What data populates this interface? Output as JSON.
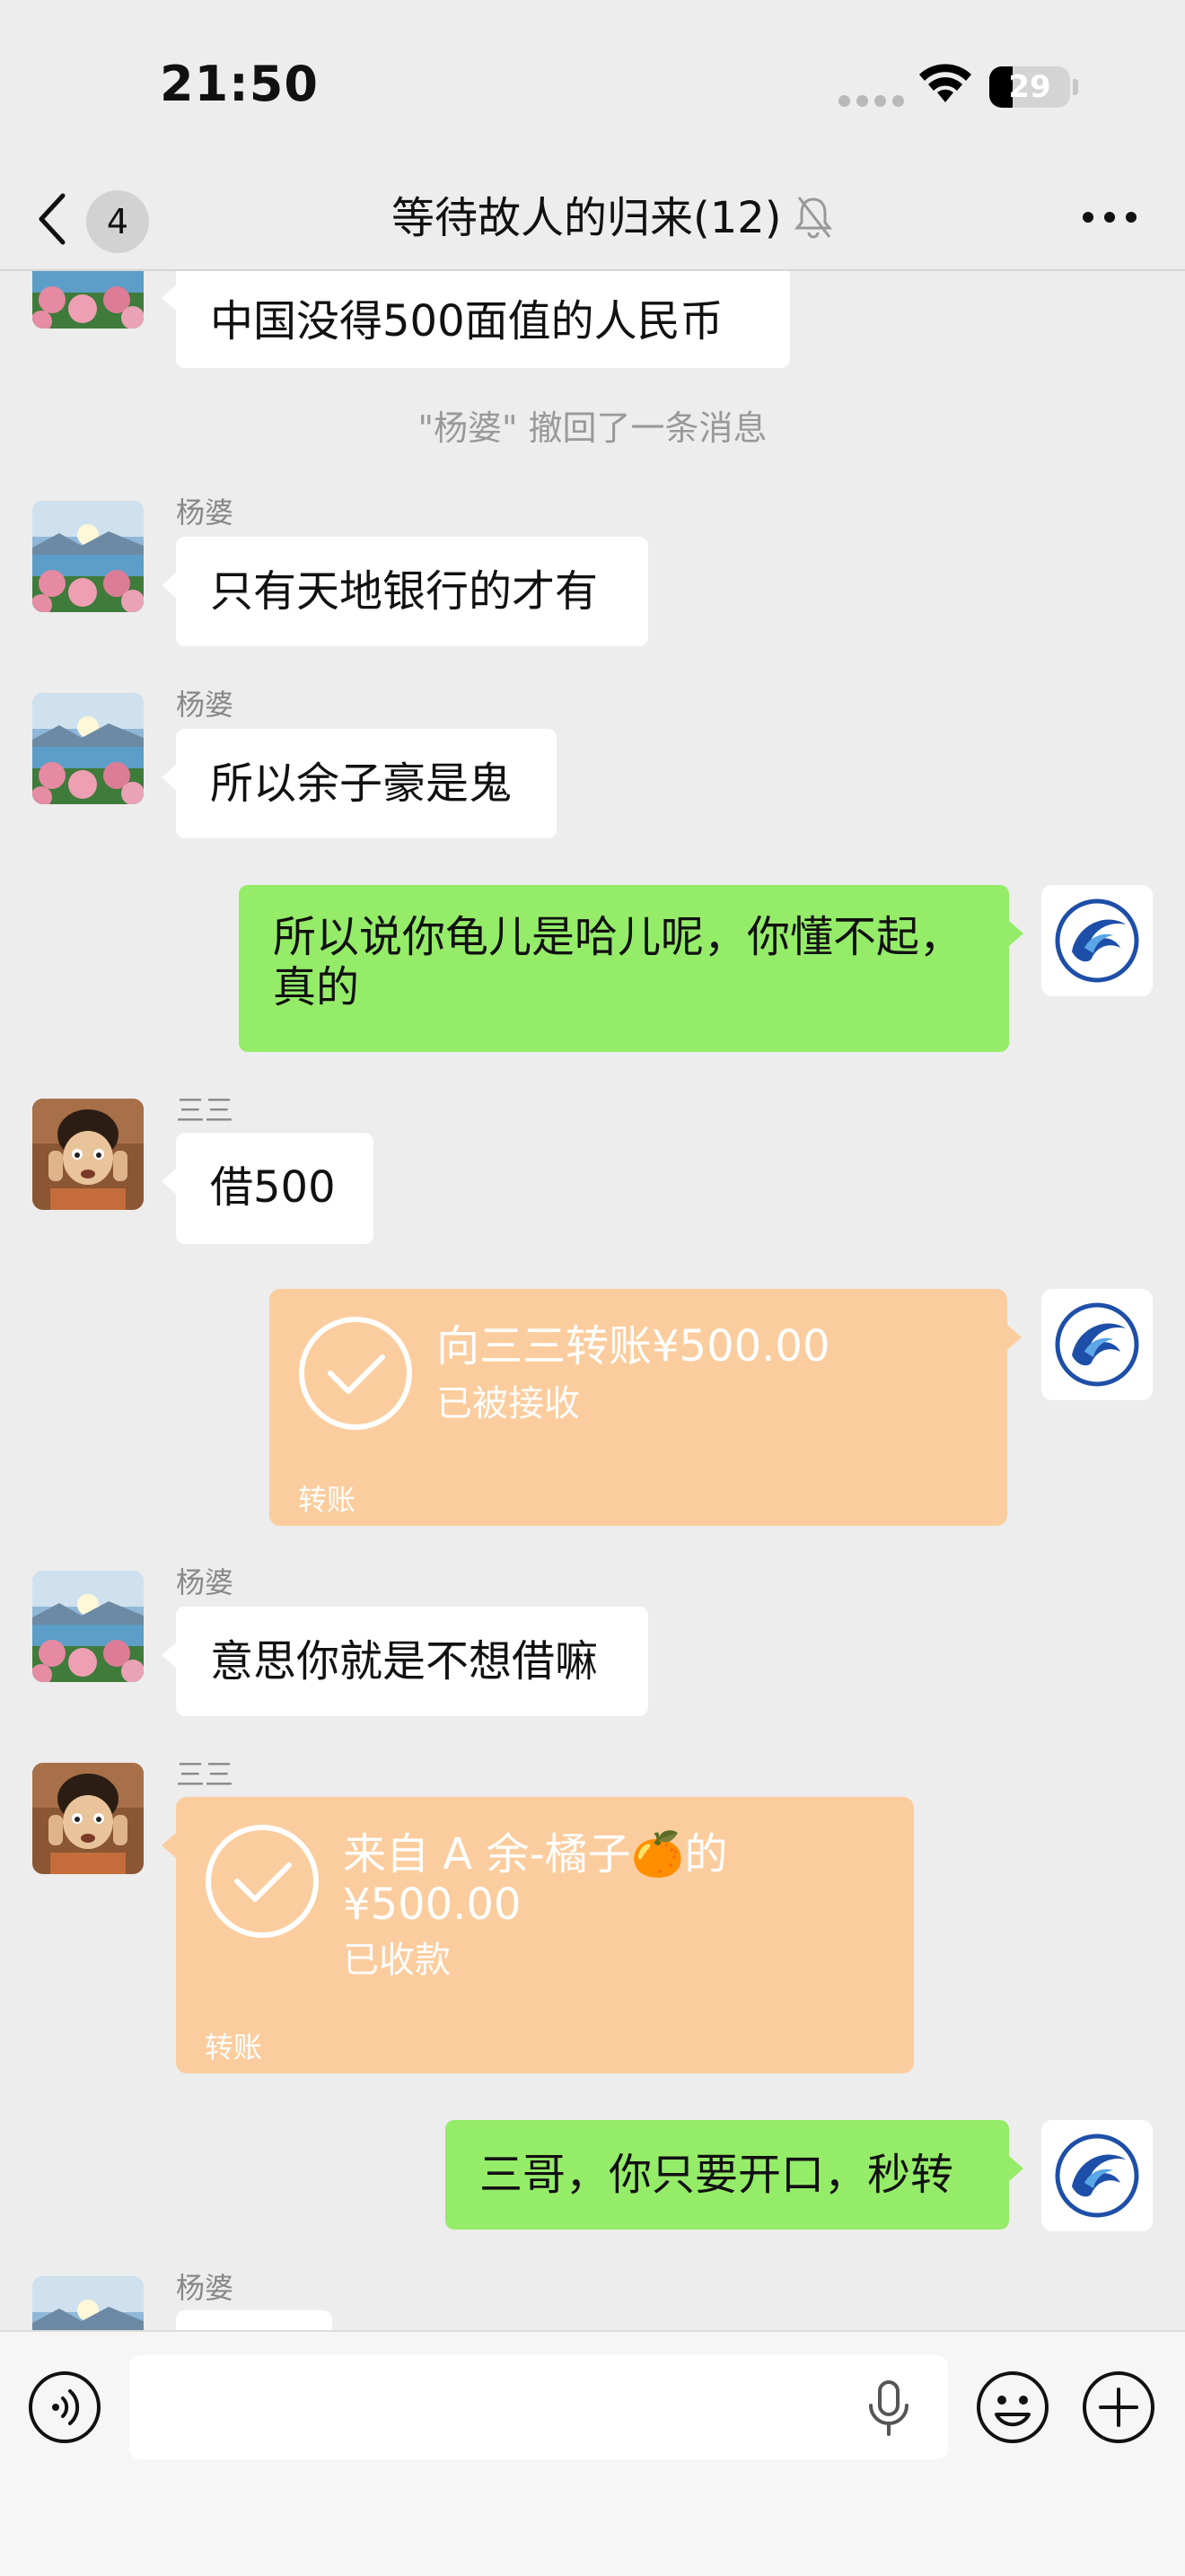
{
  "status": {
    "time": "21:50",
    "battery": "29",
    "battery_level": 0.29
  },
  "header": {
    "back_count": "4",
    "title": "等待故人的归来(12)"
  },
  "messages": [
    {
      "text": "中国没得500面值的人民币"
    },
    {
      "system": "\"杨婆\" 撤回了一条消息"
    },
    {
      "sender": "杨婆",
      "text": "只有天地银行的才有"
    },
    {
      "sender": "杨婆",
      "text": "所以余子豪是鬼"
    },
    {
      "line1": "所以说你龟儿是哈儿呢，你懂不起，",
      "line2": "真的"
    },
    {
      "sender": "三三",
      "text": "借500"
    },
    {
      "title": "向三三转账¥500.00",
      "status": "已被接收",
      "label": "转账"
    },
    {
      "sender": "杨婆",
      "text": "意思你就是不想借嘛"
    },
    {
      "sender": "三三",
      "title_line1": "来自 A 余-橘子🍊的",
      "title_line2": "¥500.00",
      "status": "已收款",
      "label": "转账"
    },
    {
      "text": "三哥，你只要开口，秒转"
    },
    {
      "sender": "杨婆"
    }
  ],
  "input": {
    "value": ""
  },
  "colors": {
    "background": "#ededed",
    "outgoing_bubble": "#95ec69",
    "incoming_bubble": "#ffffff",
    "transfer_card": "#fbcd9e"
  }
}
